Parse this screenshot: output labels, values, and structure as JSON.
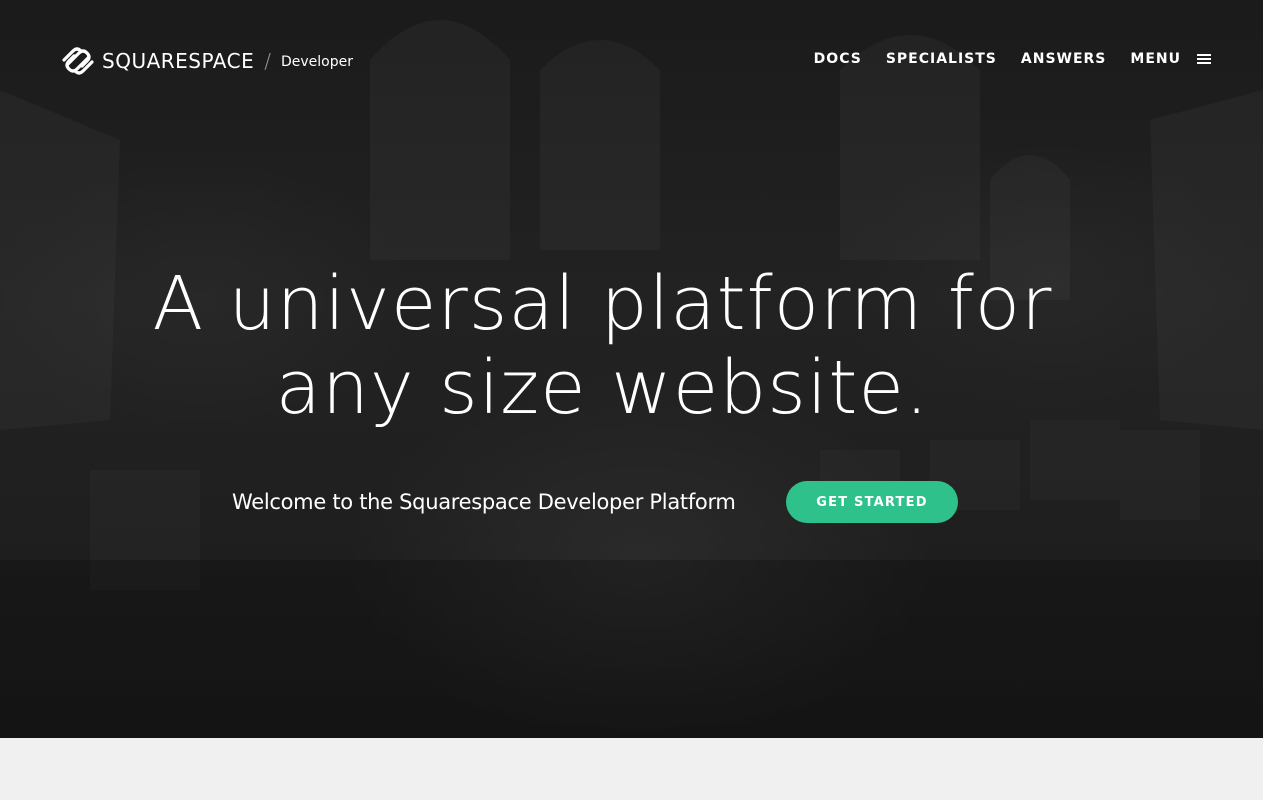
{
  "brand": {
    "name": "SQUARESPACE",
    "separator": "/",
    "product": "Developer",
    "logo_icon": "squarespace-logo-icon"
  },
  "nav": {
    "items": [
      {
        "label": "DOCS"
      },
      {
        "label": "SPECIALISTS"
      },
      {
        "label": "ANSWERS"
      }
    ],
    "menu_label": "MENU",
    "menu_icon": "hamburger-icon"
  },
  "hero": {
    "headline_line1": "A universal platform for",
    "headline_line2": "any size website.",
    "welcome": "Welcome to the Squarespace Developer Platform",
    "cta_label": "GET STARTED"
  },
  "colors": {
    "accent": "#2fc18c",
    "hero_overlay": "#242424",
    "footer_band": "#f0f0f0"
  }
}
